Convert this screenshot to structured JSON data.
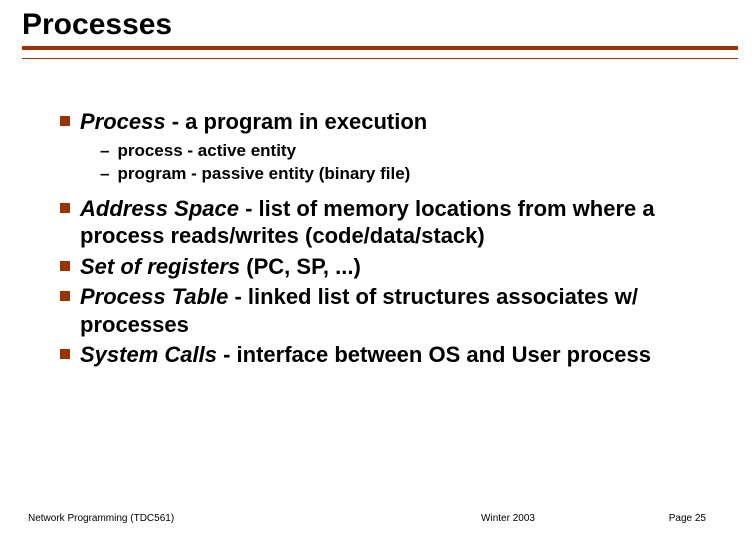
{
  "title": "Processes",
  "bullets": [
    {
      "italic": "Process",
      "rest": " - a program in execution",
      "sub": [
        "process - active entity",
        "program - passive entity (binary file)"
      ]
    },
    {
      "italic": "Address Space",
      "rest": " - list of memory locations from where a process reads/writes (code/data/stack)"
    },
    {
      "italic": "Set of registers",
      "rest": " (PC, SP, ...)"
    },
    {
      "italic": "Process Table",
      "rest": " - linked list of structures associates w/ processes"
    },
    {
      "italic": "System Calls",
      "rest": " - interface between OS and User process"
    }
  ],
  "footer": {
    "left": "Network Programming (TDC561)",
    "center": "Winter   2003",
    "right": "Page 25"
  }
}
